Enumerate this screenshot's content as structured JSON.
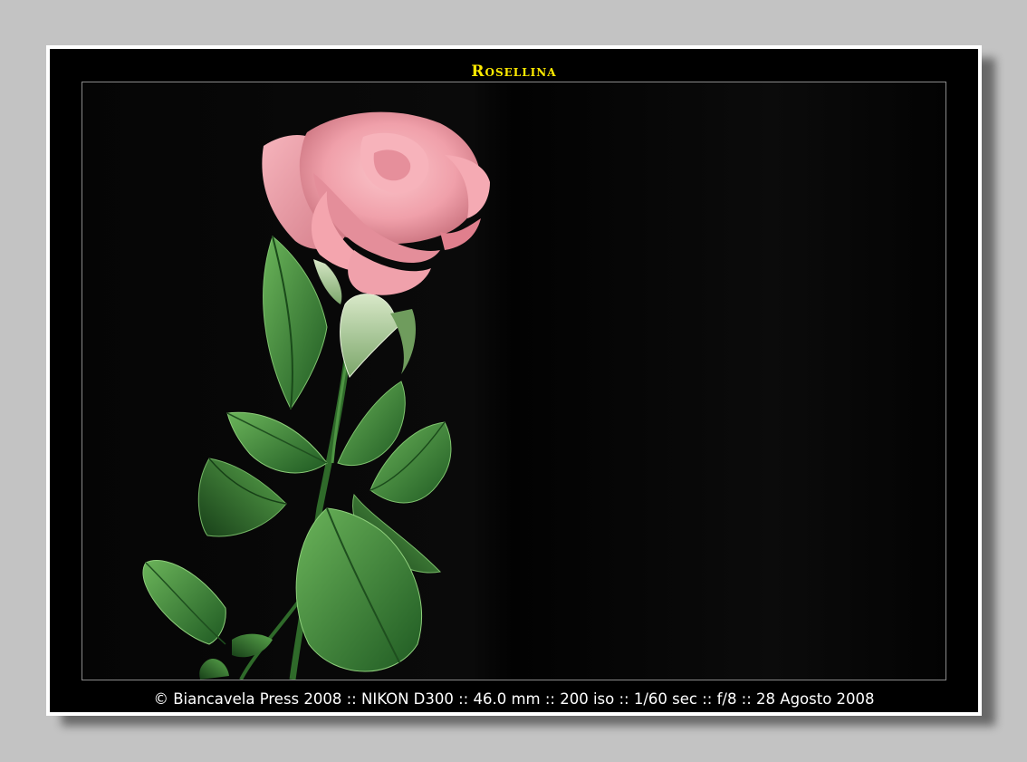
{
  "photo": {
    "title": "Rosellina",
    "caption": "© Biancavela Press 2008 :: NIKON D300 :: 46.0 mm :: 200 iso :: 1/60 sec :: f/8 :: 28 Agosto 2008",
    "subject": "pink-rose-on-black",
    "colors": {
      "background": "#c3c3c3",
      "frame": "#000000",
      "border": "#ffffff",
      "title": "#ffea00",
      "caption": "#ffffff",
      "rose": "#f3a3ad",
      "leaf": "#3f8a3a"
    }
  }
}
